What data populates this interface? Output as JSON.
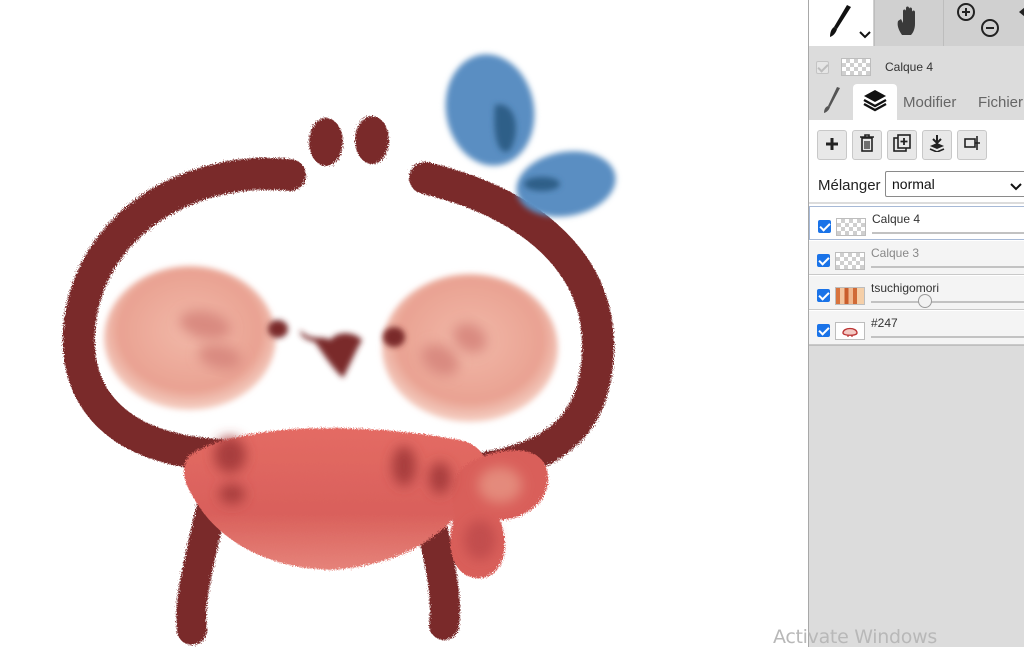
{
  "panel": {
    "tools": [
      {
        "name": "brush",
        "icon": "brush-icon",
        "active": true
      },
      {
        "name": "hand",
        "icon": "hand-icon",
        "active": false
      },
      {
        "name": "zoom",
        "icon": "zoom-icon",
        "active": false
      }
    ],
    "current_layer": {
      "name": "Calque 4"
    },
    "tabs": {
      "brush_icon": "brush-icon",
      "layers_icon": "layers-icon",
      "modifier": "Modifier",
      "fichier": "Fichier"
    },
    "layer_tools": [
      "add-layer-icon",
      "delete-layer-icon",
      "duplicate-layer-icon",
      "merge-down-icon",
      "transform-icon"
    ],
    "blend": {
      "label": "Mélanger",
      "value": "normal"
    },
    "layers": [
      {
        "name": "Calque 4",
        "visible": true,
        "selected": true
      },
      {
        "name": "Calque 3",
        "visible": true,
        "selected": false,
        "faded": true
      },
      {
        "name": "tsuchigomori",
        "visible": true,
        "selected": false,
        "opacity": 0.34
      },
      {
        "name": "#247",
        "visible": true,
        "selected": false
      }
    ]
  },
  "colors": {
    "outline": "#7a2a2a",
    "cheek": "#eaa99a",
    "scarf": "#d95f5a",
    "bow": "#4a7fb0",
    "accent": "#1a73e8"
  },
  "watermark": "Activate Windows"
}
